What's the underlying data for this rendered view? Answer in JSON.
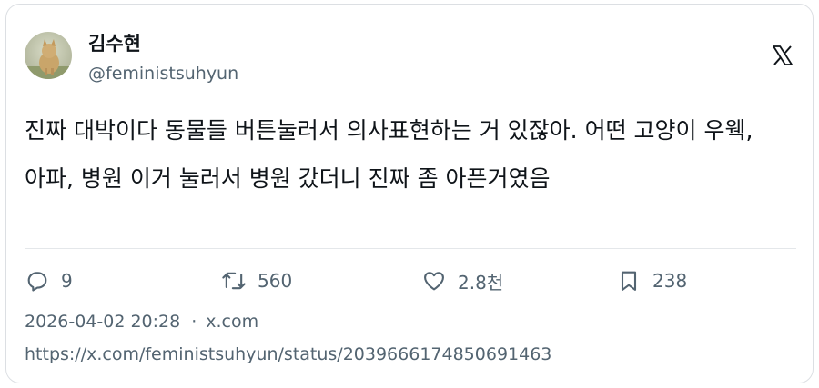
{
  "author": {
    "name": "김수현",
    "handle": "@feministsuhyun",
    "avatar_icon": "cat-photo-avatar"
  },
  "platform": {
    "logo_icon": "x-logo-icon"
  },
  "tweet": {
    "text": "진짜 대박이다 동물들 버튼눌러서 의사표현하는 거 있잖아. 어떤 고양이 우웩, 아파, 병원 이거 눌러서 병원 갔더니 진짜 좀 아픈거였음"
  },
  "stats": {
    "replies": "9",
    "retweets": "560",
    "likes": "2.8천",
    "bookmarks": "238"
  },
  "meta": {
    "timestamp": "2026-04-02 20:28",
    "separator": "·",
    "source": "x.com",
    "url": "https://x.com/feministsuhyun/status/2039666174850691463"
  },
  "colors": {
    "text": "#0f1419",
    "secondary": "#536471",
    "border": "#dcdfe3"
  }
}
